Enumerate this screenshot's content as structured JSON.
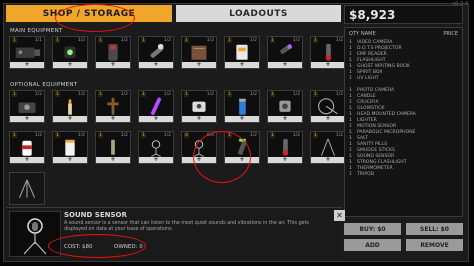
{
  "tabs": {
    "shop": "SHOP / STORAGE",
    "loadouts": "LOADOUTS"
  },
  "money": "$8,923",
  "corner_tag": "v0.3.3",
  "main_equipment": {
    "label": "MAIN EQUIPMENT",
    "slots": [
      {
        "count": "1",
        "owned": "1/1",
        "icon": "video-camera-icon"
      },
      {
        "count": "1",
        "owned": "1/2",
        "icon": "dots-projector-icon"
      },
      {
        "count": "1",
        "owned": "1/2",
        "icon": "emf-reader-icon"
      },
      {
        "count": "1",
        "owned": "1/2",
        "icon": "flashlight-icon"
      },
      {
        "count": "1",
        "owned": "1/2",
        "icon": "ghost-writing-book-icon"
      },
      {
        "count": "1",
        "owned": "1/2",
        "icon": "spirit-box-icon"
      },
      {
        "count": "1",
        "owned": "1/2",
        "icon": "uv-light-icon"
      },
      {
        "count": "1",
        "owned": "1/2",
        "icon": "thermometer-icon"
      }
    ]
  },
  "optional_equipment": {
    "label": "OPTIONAL EQUIPMENT",
    "slots": [
      {
        "count": "1",
        "owned": "1/2",
        "icon": "photo-camera-icon"
      },
      {
        "count": "1",
        "owned": "1/2",
        "icon": "candle-icon"
      },
      {
        "count": "1",
        "owned": "1/2",
        "icon": "crucifix-icon"
      },
      {
        "count": "1",
        "owned": "1/2",
        "icon": "glowstick-icon"
      },
      {
        "count": "1",
        "owned": "1/2",
        "icon": "head-mounted-camera-icon"
      },
      {
        "count": "1",
        "owned": "1/2",
        "icon": "lighter-icon"
      },
      {
        "count": "1",
        "owned": "1/2",
        "icon": "motion-sensor-icon"
      },
      {
        "count": "1",
        "owned": "1/2",
        "icon": "parabolic-microphone-icon"
      },
      {
        "count": "1",
        "owned": "1/2",
        "icon": "salt-icon"
      },
      {
        "count": "1",
        "owned": "1/2",
        "icon": "sanity-pills-icon"
      },
      {
        "count": "1",
        "owned": "1/2",
        "icon": "smudge-sticks-icon"
      },
      {
        "count": "1",
        "owned": "1/2",
        "icon": "sound-sensor-icon"
      },
      {
        "count": "0",
        "owned": "0/4",
        "icon": "sound-sensor-icon"
      },
      {
        "count": "1",
        "owned": "1/2",
        "icon": "strong-flashlight-icon"
      },
      {
        "count": "1",
        "owned": "1/2",
        "icon": "thermometer-icon"
      },
      {
        "count": "1",
        "owned": "1/2",
        "icon": "tripod-icon"
      }
    ],
    "extra_slot": {
      "icon": "tripod-icon"
    }
  },
  "list": {
    "headers": {
      "qty": "QTY",
      "name": "NAME",
      "price": "PRICE"
    },
    "group1": [
      "VIDEO CAMERA",
      "D.O.T.S PROJECTOR",
      "EMF READER",
      "FLASHLIGHT",
      "GHOST WRITING BOOK",
      "SPIRIT BOX",
      "UV LIGHT"
    ],
    "group2": [
      "PHOTO CAMERA",
      "CANDLE",
      "CRUCIFIX",
      "GLOWSTICK",
      "HEAD MOUNTED CAMERA",
      "LIGHTER",
      "MOTION SENSOR",
      "PARABOLIC MICROPHONE",
      "SALT",
      "SANITY PILLS",
      "SMUDGE STICKS",
      "SOUND SENSOR",
      "STRONG FLASHLIGHT",
      "THERMOMETER",
      "TRIPOD"
    ],
    "qty_mark": "1"
  },
  "buttons": {
    "buy": "BUY: $0",
    "sell": "SELL: $0",
    "add": "ADD",
    "remove": "REMOVE"
  },
  "info": {
    "title": "SOUND SENSOR",
    "description": "A sound sensor is a sensor that can listen to the most quiet sounds and vibrations in the air. This gets displayed on data at your base of operations.",
    "cost": "COST: $80",
    "owned": "OWNED: 0",
    "close": "✕"
  },
  "colors": {
    "accent": "#f0a62b",
    "markup": "#e11111"
  }
}
